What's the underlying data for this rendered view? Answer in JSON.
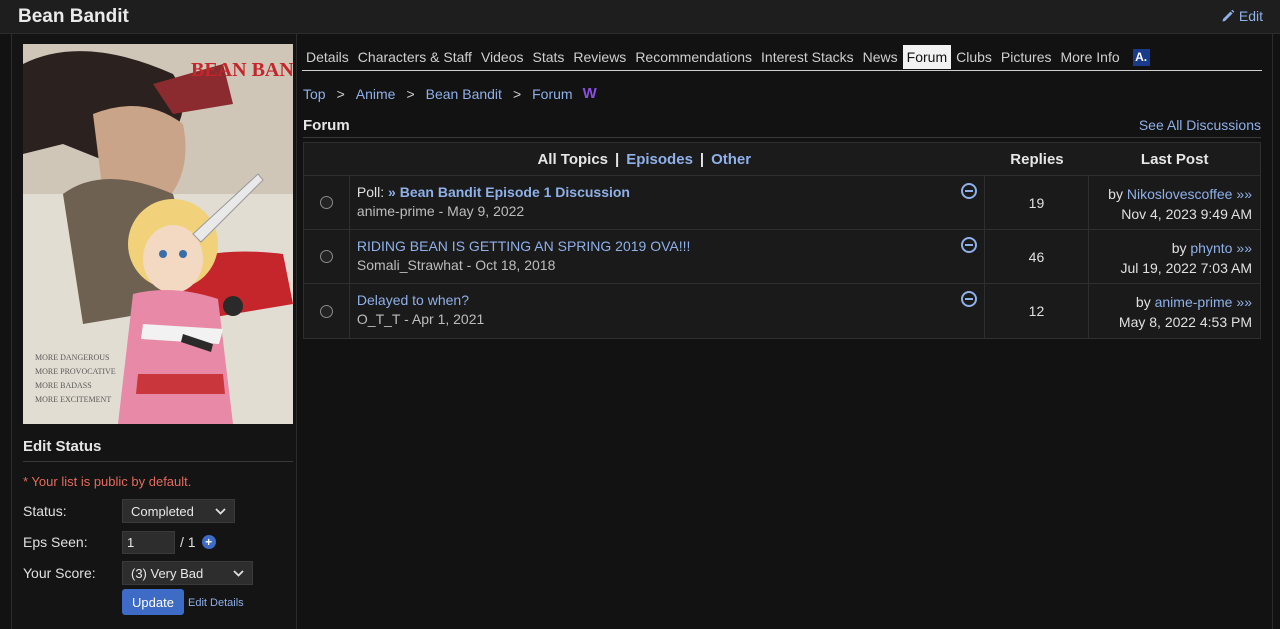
{
  "header": {
    "title": "Bean Bandit",
    "edit_label": "Edit"
  },
  "sidebar": {
    "cover_title": "BEAN BANDIT",
    "cover_lines": [
      "MORE DANGEROUS",
      "MORE PROVOCATIVE",
      "MORE BADASS",
      "MORE EXCITEMENT"
    ],
    "edit_status_title": "Edit Status",
    "public_note": "* Your list is public by default.",
    "status_label": "Status:",
    "status_value": "Completed",
    "eps_label": "Eps Seen:",
    "eps_value": "1",
    "eps_total": "/ 1",
    "score_label": "Your Score:",
    "score_value": "(3) Very Bad",
    "update_label": "Update",
    "edit_details_label": "Edit Details"
  },
  "tabs": [
    {
      "label": "Details"
    },
    {
      "label": "Characters & Staff"
    },
    {
      "label": "Videos"
    },
    {
      "label": "Stats"
    },
    {
      "label": "Reviews"
    },
    {
      "label": "Recommendations"
    },
    {
      "label": "Interest Stacks"
    },
    {
      "label": "News"
    },
    {
      "label": "Forum",
      "active": true
    },
    {
      "label": "Clubs"
    },
    {
      "label": "Pictures"
    },
    {
      "label": "More Info"
    }
  ],
  "breadcrumb": [
    "Top",
    "Anime",
    "Bean Bandit",
    "Forum"
  ],
  "forum": {
    "heading": "Forum",
    "see_all": "See All Discussions",
    "header": {
      "all_topics": "All Topics",
      "episodes": "Episodes",
      "other": "Other",
      "replies": "Replies",
      "last_post": "Last Post"
    },
    "topics": [
      {
        "prefix": "Poll: ",
        "title": "» Bean Bandit Episode 1 Discussion",
        "bold": true,
        "author": "anime-prime",
        "date": "May 9, 2022",
        "replies": "19",
        "last_by": "Nikoslovescoffee",
        "last_date": "Nov 4, 2023 9:49 AM"
      },
      {
        "prefix": "",
        "title": "RIDING BEAN IS GETTING AN SPRING 2019 OVA!!!",
        "bold": false,
        "author": "Somali_Strawhat",
        "date": "Oct 18, 2018",
        "replies": "46",
        "last_by": "phynto",
        "last_date": "Jul 19, 2022 7:03 AM"
      },
      {
        "prefix": "",
        "title": "Delayed to when?",
        "bold": false,
        "author": "O_T_T",
        "date": "Apr 1, 2021",
        "replies": "12",
        "last_by": "anime-prime",
        "last_date": "May 8, 2022 4:53 PM"
      }
    ]
  }
}
